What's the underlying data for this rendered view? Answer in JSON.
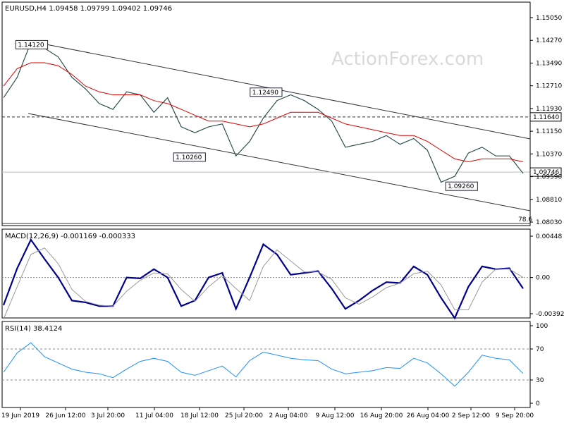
{
  "chart_data": [
    {
      "type": "line",
      "title": "EURUSD,H4 1.09458 1.09799 1.09402 1.09746",
      "watermark": "ActionForex.com",
      "yticks": [
        "1.15050",
        "1.14270",
        "1.13490",
        "1.12710",
        "1.11930",
        "1.11150",
        "1.10370",
        "1.09590",
        "1.08810",
        "1.08030"
      ],
      "ylim": [
        1.0803,
        1.1505
      ],
      "current_price_label": "1.09746",
      "current_price": 1.09746,
      "resistance_label": "1.11640",
      "resistance": 1.1164,
      "fib_label": "78.6",
      "annotations": [
        "1.14120",
        "1.12490",
        "1.10260",
        "1.09260"
      ],
      "series": [
        {
          "values": [
            1.123,
            1.13,
            1.142,
            1.14,
            1.137,
            1.13,
            1.126,
            1.121,
            1.119,
            1.125,
            1.124,
            1.118,
            1.123,
            1.113,
            1.111,
            1.113,
            1.114,
            1.103,
            1.108,
            1.116,
            1.122,
            1.124,
            1.122,
            1.119,
            1.115,
            1.106,
            1.107,
            1.108,
            1.11,
            1.107,
            1.109,
            1.105,
            1.094,
            1.096,
            1.104,
            1.106,
            1.103,
            1.103,
            1.097
          ],
          "color": "#2f4f4f"
        },
        {
          "values": [
            1.127,
            1.133,
            1.135,
            1.135,
            1.134,
            1.131,
            1.127,
            1.125,
            1.124,
            1.124,
            1.124,
            1.122,
            1.121,
            1.119,
            1.117,
            1.115,
            1.115,
            1.114,
            1.113,
            1.114,
            1.116,
            1.118,
            1.118,
            1.118,
            1.116,
            1.114,
            1.113,
            1.112,
            1.111,
            1.11,
            1.11,
            1.108,
            1.105,
            1.102,
            1.101,
            1.102,
            1.102,
            1.102,
            1.101
          ],
          "color": "#e00000"
        }
      ]
    },
    {
      "type": "line",
      "title": "MACD(12,26,9) -0.001169 -0.000333",
      "yticks": [
        "0.00448",
        "0.00",
        "-0.003928"
      ],
      "ylim": [
        -0.003928,
        0.00448
      ],
      "series": [
        {
          "values": [
            -0.003,
            0.001,
            0.0041,
            0.002,
            0.0,
            -0.0025,
            -0.0027,
            -0.0031,
            -0.0031,
            0.0,
            -0.0001,
            0.0009,
            0.0,
            -0.0031,
            -0.0025,
            0.0,
            0.0005,
            -0.0034,
            0.0,
            0.0036,
            0.0025,
            0.0003,
            0.0005,
            0.0007,
            -0.0012,
            -0.0034,
            -0.0025,
            -0.0014,
            -0.0005,
            -0.0006,
            0.0012,
            0.0003,
            -0.0022,
            -0.0044,
            -0.001,
            0.0012,
            0.0009,
            0.001,
            -0.0012
          ],
          "color": "#00008b"
        },
        {
          "values": [
            -0.0045,
            -0.001,
            0.0025,
            0.0032,
            0.0015,
            -0.0013,
            -0.0026,
            -0.003,
            -0.0031,
            -0.0015,
            -0.0003,
            0.0005,
            0.0004,
            -0.0013,
            -0.0026,
            -0.001,
            0.0002,
            -0.0012,
            -0.0025,
            0.0012,
            0.003,
            0.0018,
            0.0006,
            0.0006,
            -0.0002,
            -0.0022,
            -0.0029,
            -0.0021,
            -0.0011,
            -0.0006,
            0.0004,
            0.0007,
            -0.0008,
            -0.0035,
            -0.0035,
            -0.0005,
            0.0009,
            0.0009,
            0.0
          ]
        }
      ]
    },
    {
      "type": "line",
      "title": "RSI(14) 38.4124",
      "yticks": [
        "100",
        "70",
        "30",
        "0"
      ],
      "ylim": [
        0,
        100
      ],
      "levels": [
        70,
        30
      ],
      "series": [
        {
          "values": [
            40,
            65,
            78,
            60,
            52,
            44,
            40,
            38,
            33,
            44,
            54,
            58,
            54,
            40,
            36,
            42,
            48,
            34,
            55,
            66,
            62,
            58,
            56,
            55,
            44,
            38,
            40,
            42,
            46,
            45,
            58,
            52,
            38,
            22,
            40,
            62,
            58,
            56,
            38.4
          ],
          "color": "#1e90ff"
        }
      ]
    }
  ],
  "x_axis": {
    "labels": [
      "19 Jun 2019",
      "26 Jun 12:00",
      "3 Jul 20:00",
      "11 Jul 04:00",
      "18 Jul 12:00",
      "25 Jul 20:00",
      "2 Aug 04:00",
      "9 Aug 12:00",
      "16 Aug 20:00",
      "26 Aug 04:00",
      "2 Sep 12:00",
      "9 Sep 20:00"
    ]
  }
}
